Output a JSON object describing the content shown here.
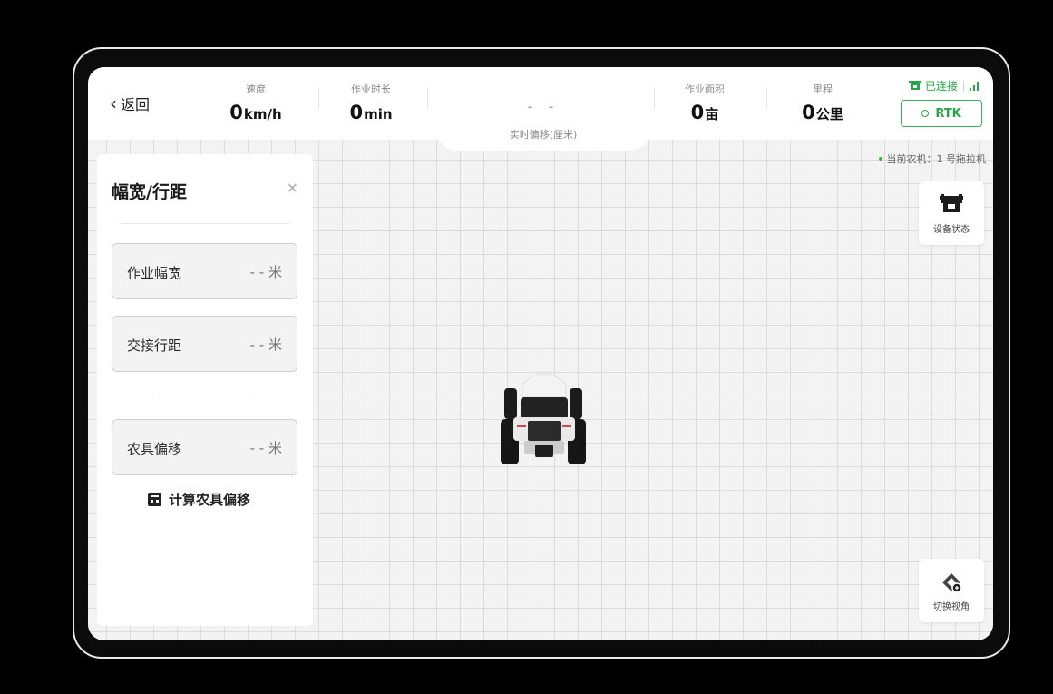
{
  "header": {
    "back_label": "返回",
    "stats": [
      {
        "caption": "速度",
        "value": "0",
        "unit": "km/h"
      },
      {
        "caption": "作业时长",
        "value": "0",
        "unit": "min"
      },
      {
        "caption": "作业面积",
        "value": "0",
        "unit": "亩"
      },
      {
        "caption": "里程",
        "value": "0",
        "unit": "公里"
      }
    ],
    "offset_value": "- -",
    "offset_caption": "实时偏移(厘米)",
    "connection_status": "已连接",
    "rtk_label": "RTK"
  },
  "current_machine": "当前农机：1 号拖拉机",
  "panel": {
    "title": "幅宽/行距",
    "close_label": "×",
    "fields": [
      {
        "label": "作业幅宽",
        "value": "- - 米"
      },
      {
        "label": "交接行距",
        "value": "- - 米"
      },
      {
        "label": "农具偏移",
        "value": "- - 米"
      }
    ],
    "calc_label": "计算农具偏移"
  },
  "side_buttons": {
    "device_status": "设备状态",
    "switch_view": "切换视角"
  },
  "colors": {
    "accent": "#2aa64a",
    "grid_bg": "#f3f3f3"
  }
}
